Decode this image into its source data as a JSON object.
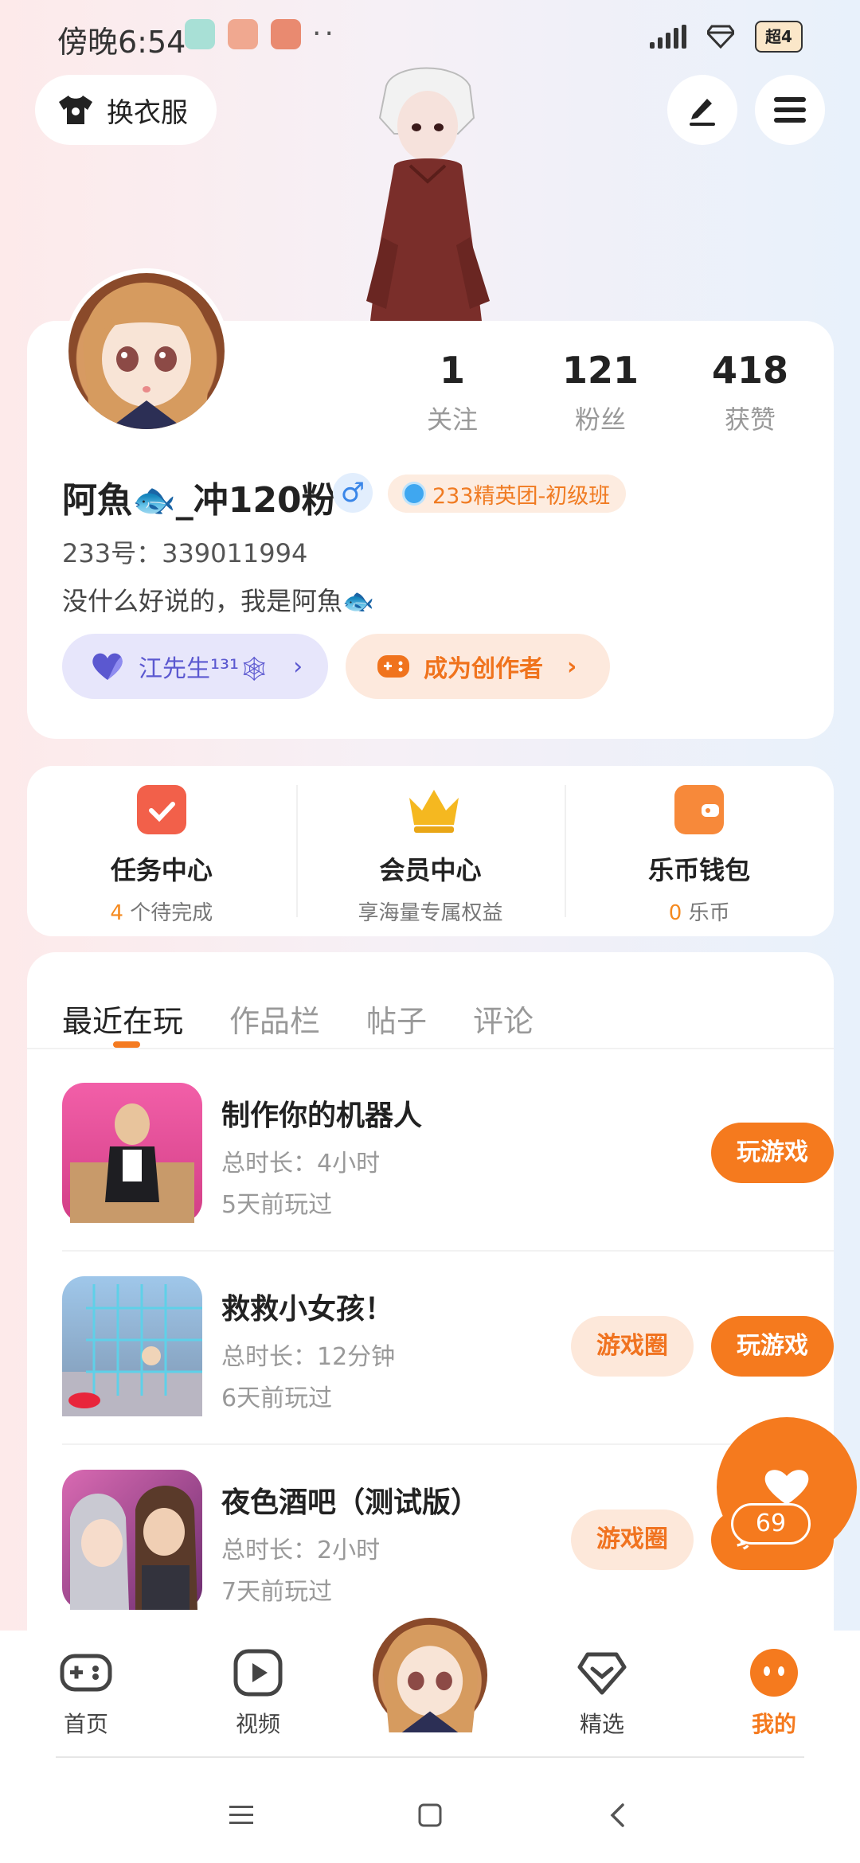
{
  "status": {
    "time": "傍晚6:54",
    "dots": "··",
    "brand": "超4"
  },
  "header": {
    "dress_label": "换衣服"
  },
  "profile": {
    "stats": [
      {
        "num": "1",
        "label": "关注"
      },
      {
        "num": "121",
        "label": "粉丝"
      },
      {
        "num": "418",
        "label": "获赞"
      }
    ],
    "nickname": "阿魚🐟_冲120粉",
    "gender_symbol": "♂",
    "rank": "233精英团-初级班",
    "uid": "233号：339011994",
    "bio": "没什么好说的，我是阿魚🐟",
    "friend_chip": "江先生¹³¹🕸",
    "creator_chip": "成为创作者"
  },
  "services": [
    {
      "title": "任务中心",
      "count": "4",
      "sub": " 个待完成",
      "color": "#f2604a"
    },
    {
      "title": "会员中心",
      "count": "",
      "sub": "享海量专属权益",
      "color": "#f5b820"
    },
    {
      "title": "乐币钱包",
      "count": "0",
      "sub": " 乐币",
      "color": "#f7893a"
    }
  ],
  "tabs": [
    "最近在玩",
    "作品栏",
    "帖子",
    "评论"
  ],
  "games": [
    {
      "name": "制作你的机器人",
      "duration": "总时长：4小时",
      "last": "5天前玩过",
      "play": "玩游戏",
      "circle": ""
    },
    {
      "name": "救救小女孩！",
      "duration": "总时长：12分钟",
      "last": "6天前玩过",
      "play": "玩游戏",
      "circle": "游戏圈"
    },
    {
      "name": "夜色酒吧（测试版）",
      "duration": "总时长：2小时",
      "last": "7天前玩过",
      "play": "玩游戏",
      "circle": "游戏圈"
    }
  ],
  "like_count": "69",
  "nav": [
    {
      "label": "首页"
    },
    {
      "label": "视频"
    },
    {
      "label": "精选"
    },
    {
      "label": "我的"
    }
  ],
  "colors": {
    "accent": "#f57a1e",
    "friend": "#5b58d0"
  }
}
